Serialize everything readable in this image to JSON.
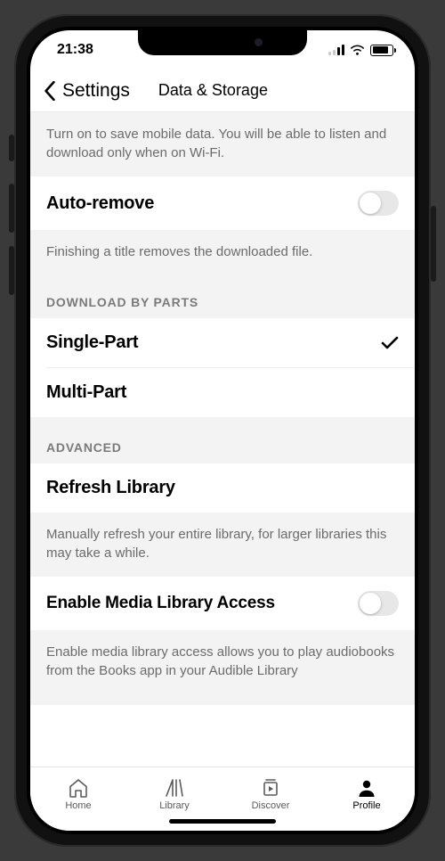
{
  "status": {
    "time": "21:38"
  },
  "nav": {
    "back_label": "Settings",
    "title": "Data & Storage"
  },
  "notes": {
    "wifi_only": "Turn on to save mobile data. You will be able to listen and download only when on Wi-Fi.",
    "auto_remove": "Finishing a title removes the downloaded file.",
    "refresh": "Manually refresh your entire library, for larger libraries this may take a while.",
    "media_access": "Enable media library access allows you to play audiobooks from the Books app in your Audible Library"
  },
  "rows": {
    "auto_remove": "Auto-remove",
    "single_part": "Single-Part",
    "multi_part": "Multi-Part",
    "refresh_library": "Refresh Library",
    "enable_media": "Enable Media Library Access"
  },
  "sections": {
    "download_by_parts": "DOWNLOAD BY PARTS",
    "advanced": "ADVANCED"
  },
  "tabs": {
    "home": "Home",
    "library": "Library",
    "discover": "Discover",
    "profile": "Profile"
  }
}
